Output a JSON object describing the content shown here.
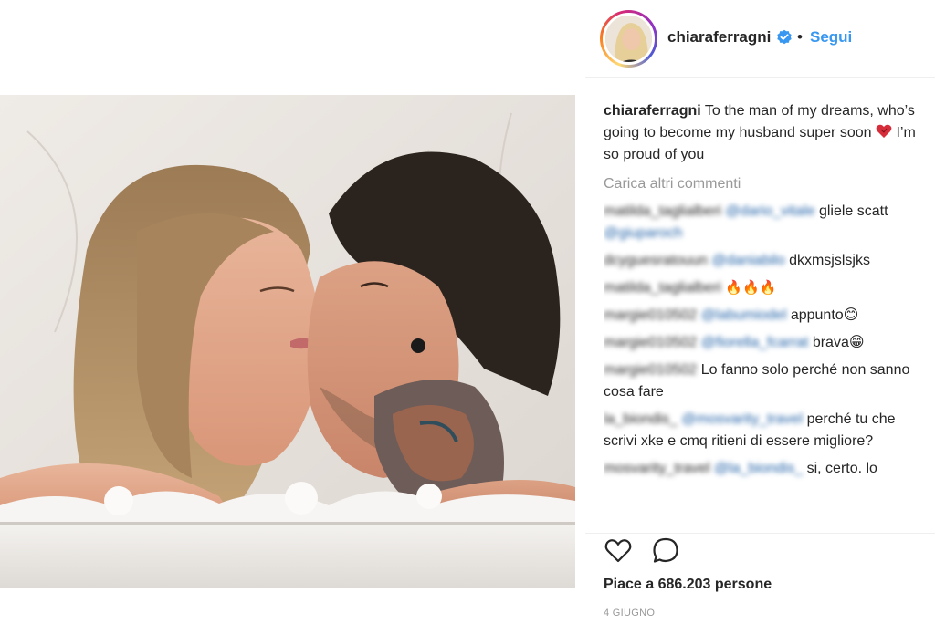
{
  "post": {
    "image_alt": "photo",
    "username": "chiaraferragni",
    "separator": "•",
    "follow_label": "Segui",
    "caption": {
      "username": "chiaraferragni",
      "text_before_emoji": "To the man of my dreams, who’s going to become my husband super soon",
      "emoji": "heart-emoji",
      "text_after_emoji": "I’m so proud of you"
    },
    "load_more_label": "Carica altri commenti",
    "comments": [
      {
        "username": "matilda_taglialberi",
        "mention": "@dario_vitale",
        "text": "gliele scatt",
        "mention2": "@giuparoch"
      },
      {
        "username": "dcyguesratouun",
        "mention": "@daniabilo",
        "text": "dkxmsjslsjks"
      },
      {
        "username": "matilda_taglialberi",
        "mention": "",
        "text": "🔥🔥🔥"
      },
      {
        "username": "margie010502",
        "mention": "@labumiodel",
        "text": "appunto😊"
      },
      {
        "username": "margie010502",
        "mention": "@fiorella_fcarrat",
        "text": "brava😁"
      },
      {
        "username": "margie010502",
        "mention": "",
        "text": "Lo fanno solo perché non sanno cosa fare"
      },
      {
        "username": "la_biondis_",
        "mention": "@mosvarity_travel",
        "text": "perché tu che scrivi xke e cmq ritieni di essere migliore?"
      },
      {
        "username": "mosvarity_travel",
        "mention": "@la_biondis_",
        "text": "si, certo. lo"
      }
    ],
    "likes_text": "Piace a 686.203 persone",
    "date": "4 GIUGNO",
    "icons": {
      "like": "heart-outline-icon",
      "comment": "comment-bubble-icon",
      "verified": "verified-badge-icon"
    },
    "colors": {
      "link": "#3897f0",
      "muted": "#999999",
      "text": "#262626",
      "verified": "#3897f0",
      "divider": "#efefef"
    }
  }
}
